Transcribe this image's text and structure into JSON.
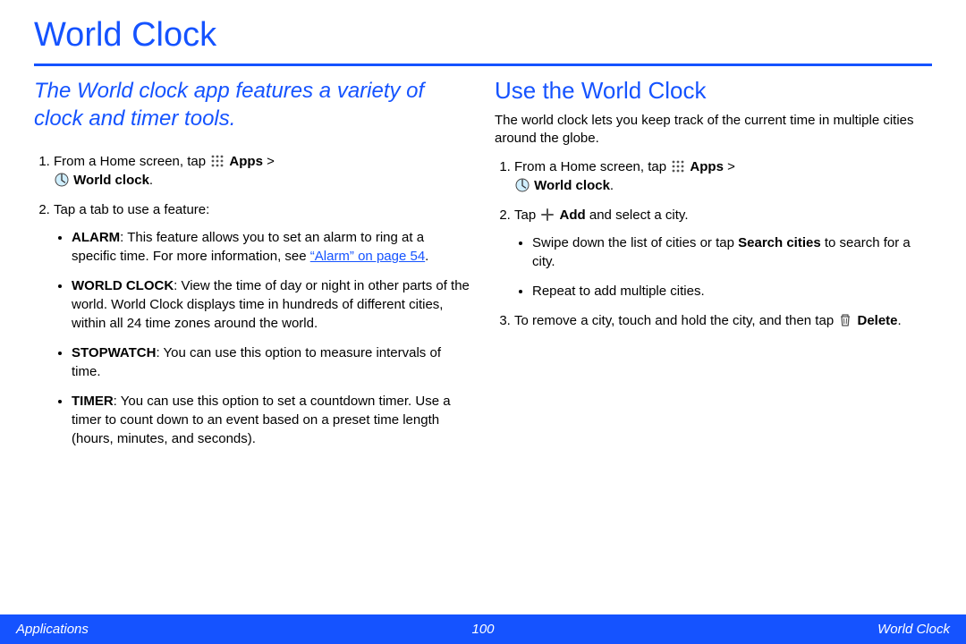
{
  "title": "World Clock",
  "intro": "The World clock app features a variety of clock and timer tools.",
  "left": {
    "step1_prefix": "From a Home screen, tap ",
    "apps_label": "Apps",
    "gt": " > ",
    "worldclock_label": "World clock",
    "step2": "Tap a tab to use a feature:",
    "alarm_label": "ALARM",
    "alarm_text_a": ": This feature allows you to set an alarm to ring at a specific time. For more information, see ",
    "alarm_link": "“Alarm” on page 54",
    "alarm_text_b": ".",
    "world_label": "WORLD CLOCK",
    "world_text": ": View the time of day or night in other parts of the world. World Clock displays time in hundreds of different cities, within all 24 time zones around the world.",
    "stopwatch_label": "STOPWATCH",
    "stopwatch_text": ": You can use this option to measure intervals of time.",
    "timer_label": "TIMER",
    "timer_text": ": You can use this option to set a countdown timer. Use a timer to count down to an event based on a preset time length (hours, minutes, and seconds)."
  },
  "right": {
    "heading": "Use the World Clock",
    "para": "The world clock lets you keep track of the current time in multiple cities around the globe.",
    "step1_prefix": "From a Home screen, tap ",
    "apps_label": "Apps",
    "gt": " > ",
    "worldclock_label": "World clock",
    "step2_prefix": "Tap ",
    "add_label": "Add",
    "step2_suffix": " and select a city.",
    "swipe_a": "Swipe down the list of cities or tap ",
    "search_label": "Search cities",
    "swipe_b": " to search for a city.",
    "repeat": "Repeat to add multiple cities.",
    "step3_a": "To remove a city, touch and hold the city, and then tap ",
    "delete_label": "Delete",
    "step3_b": "."
  },
  "footer": {
    "left": "Applications",
    "center": "100",
    "right": "World Clock"
  }
}
